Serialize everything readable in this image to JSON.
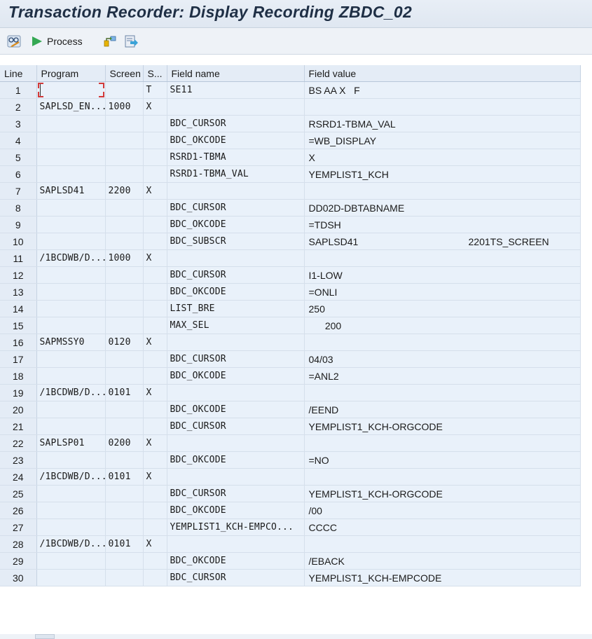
{
  "window": {
    "title": "Transaction Recorder: Display Recording ZBDC_02"
  },
  "toolbar": {
    "edit_icon": "glasses-pencil-icon",
    "process_label": "Process",
    "process_icon": "play-triangle-icon",
    "tree_icon": "hierarchy-icon",
    "export_icon": "export-arrow-icon",
    "colors": {
      "process_green": "#34a853",
      "accent_yellow": "#e8b400"
    }
  },
  "table": {
    "columns": [
      "Line",
      "Program",
      "Screen",
      "S...",
      "Field name",
      "Field value"
    ],
    "rows": [
      {
        "line": "1",
        "program": "",
        "screen": "",
        "s": "T",
        "field": "SE11",
        "value": "BS AA X   F",
        "value2": ""
      },
      {
        "line": "2",
        "program": "SAPLSD_EN...",
        "screen": "1000",
        "s": "X",
        "field": "",
        "value": "",
        "value2": ""
      },
      {
        "line": "3",
        "program": "",
        "screen": "",
        "s": "",
        "field": "BDC_CURSOR",
        "value": "RSRD1-TBMA_VAL",
        "value2": ""
      },
      {
        "line": "4",
        "program": "",
        "screen": "",
        "s": "",
        "field": "BDC_OKCODE",
        "value": "=WB_DISPLAY",
        "value2": ""
      },
      {
        "line": "5",
        "program": "",
        "screen": "",
        "s": "",
        "field": "RSRD1-TBMA",
        "value": "X",
        "value2": ""
      },
      {
        "line": "6",
        "program": "",
        "screen": "",
        "s": "",
        "field": "RSRD1-TBMA_VAL",
        "value": "YEMPLIST1_KCH",
        "value2": ""
      },
      {
        "line": "7",
        "program": "SAPLSD41",
        "screen": "2200",
        "s": "X",
        "field": "",
        "value": "",
        "value2": ""
      },
      {
        "line": "8",
        "program": "",
        "screen": "",
        "s": "",
        "field": "BDC_CURSOR",
        "value": "DD02D-DBTABNAME",
        "value2": ""
      },
      {
        "line": "9",
        "program": "",
        "screen": "",
        "s": "",
        "field": "BDC_OKCODE",
        "value": "=TDSH",
        "value2": ""
      },
      {
        "line": "10",
        "program": "",
        "screen": "",
        "s": "",
        "field": "BDC_SUBSCR",
        "value": "SAPLSD41",
        "value2": "2201TS_SCREEN"
      },
      {
        "line": "11",
        "program": "/1BCDWB/D...",
        "screen": "1000",
        "s": "X",
        "field": "",
        "value": "",
        "value2": ""
      },
      {
        "line": "12",
        "program": "",
        "screen": "",
        "s": "",
        "field": "BDC_CURSOR",
        "value": "I1-LOW",
        "value2": ""
      },
      {
        "line": "13",
        "program": "",
        "screen": "",
        "s": "",
        "field": "BDC_OKCODE",
        "value": "=ONLI",
        "value2": ""
      },
      {
        "line": "14",
        "program": "",
        "screen": "",
        "s": "",
        "field": "LIST_BRE",
        "value": "250",
        "value2": ""
      },
      {
        "line": "15",
        "program": "",
        "screen": "",
        "s": "",
        "field": "MAX_SEL",
        "value": "      200",
        "value2": ""
      },
      {
        "line": "16",
        "program": "SAPMSSY0",
        "screen": "0120",
        "s": "X",
        "field": "",
        "value": "",
        "value2": ""
      },
      {
        "line": "17",
        "program": "",
        "screen": "",
        "s": "",
        "field": "BDC_CURSOR",
        "value": "04/03",
        "value2": ""
      },
      {
        "line": "18",
        "program": "",
        "screen": "",
        "s": "",
        "field": "BDC_OKCODE",
        "value": "=ANL2",
        "value2": ""
      },
      {
        "line": "19",
        "program": "/1BCDWB/D...",
        "screen": "0101",
        "s": "X",
        "field": "",
        "value": "",
        "value2": ""
      },
      {
        "line": "20",
        "program": "",
        "screen": "",
        "s": "",
        "field": "BDC_OKCODE",
        "value": "/EEND",
        "value2": ""
      },
      {
        "line": "21",
        "program": "",
        "screen": "",
        "s": "",
        "field": "BDC_CURSOR",
        "value": "YEMPLIST1_KCH-ORGCODE",
        "value2": ""
      },
      {
        "line": "22",
        "program": "SAPLSP01",
        "screen": "0200",
        "s": "X",
        "field": "",
        "value": "",
        "value2": ""
      },
      {
        "line": "23",
        "program": "",
        "screen": "",
        "s": "",
        "field": "BDC_OKCODE",
        "value": "=NO",
        "value2": ""
      },
      {
        "line": "24",
        "program": "/1BCDWB/D...",
        "screen": "0101",
        "s": "X",
        "field": "",
        "value": "",
        "value2": ""
      },
      {
        "line": "25",
        "program": "",
        "screen": "",
        "s": "",
        "field": "BDC_CURSOR",
        "value": "YEMPLIST1_KCH-ORGCODE",
        "value2": ""
      },
      {
        "line": "26",
        "program": "",
        "screen": "",
        "s": "",
        "field": "BDC_OKCODE",
        "value": "/00",
        "value2": ""
      },
      {
        "line": "27",
        "program": "",
        "screen": "",
        "s": "",
        "field": "YEMPLIST1_KCH-EMPCO...",
        "value": "CCCC",
        "value2": ""
      },
      {
        "line": "28",
        "program": "/1BCDWB/D...",
        "screen": "0101",
        "s": "X",
        "field": "",
        "value": "",
        "value2": ""
      },
      {
        "line": "29",
        "program": "",
        "screen": "",
        "s": "",
        "field": "BDC_OKCODE",
        "value": "/EBACK",
        "value2": ""
      },
      {
        "line": "30",
        "program": "",
        "screen": "",
        "s": "",
        "field": "BDC_CURSOR",
        "value": "YEMPLIST1_KCH-EMPCODE",
        "value2": ""
      }
    ]
  }
}
